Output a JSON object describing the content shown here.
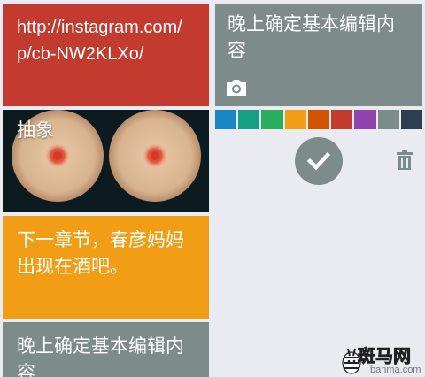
{
  "cards": {
    "link": {
      "text": "http://instagram.com/p/cb-NW2KLXo/",
      "color": "#c33a2e"
    },
    "image": {
      "title": "抽象",
      "background": "#0b1b20"
    },
    "orange": {
      "text": "下一章节，春彦妈妈出现在酒吧。",
      "color": "#f19d16"
    },
    "gray_bottom": {
      "text": "晚上确定基本编辑内容",
      "color": "#7e8b8b"
    }
  },
  "editor": {
    "text": "晚上确定基本编辑内容",
    "color": "#7e8b8b",
    "camera_icon": "camera-icon",
    "confirm_icon": "checkmark-icon",
    "delete_icon": "trash-icon",
    "palette": [
      "#1a86c8",
      "#16a085",
      "#27ae60",
      "#f19d16",
      "#d35400",
      "#c33a2e",
      "#8e44ad",
      "#7e8b8b",
      "#2c3e50"
    ]
  },
  "watermark": {
    "cn": "斑马网",
    "en": "banma.com"
  }
}
